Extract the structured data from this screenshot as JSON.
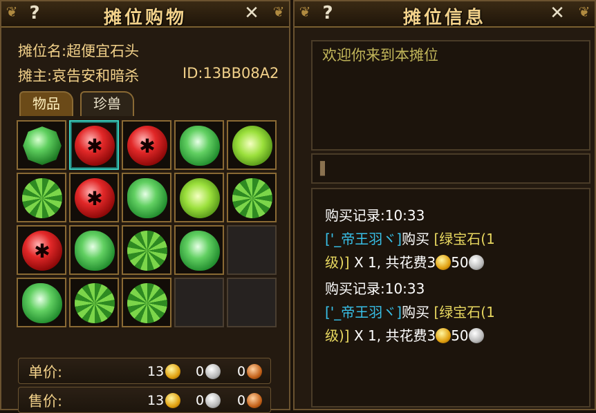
{
  "left": {
    "title": "摊位购物",
    "help": "?",
    "close": "✕",
    "stall_name": "摊位名:超便宜石头",
    "owner_label": "摊主:哀告安和暗杀",
    "owner_id": "ID:13BB08A2",
    "tabs": [
      "物品",
      "珍兽"
    ],
    "items": [
      "emerald",
      "ruby",
      "ruby",
      "jade",
      "peridot",
      "cut",
      "ruby",
      "jade",
      "peridot",
      "cut",
      "ruby",
      "jade",
      "cut",
      "jade",
      "empty",
      "jade",
      "cut",
      "cut",
      "empty",
      "empty"
    ],
    "selected_index": 1,
    "unit_price": {
      "label": "单价:",
      "gold": "13",
      "silver": "0",
      "copper": "0"
    },
    "sell_price": {
      "label": "售价:",
      "gold": "13",
      "silver": "0",
      "copper": "0"
    }
  },
  "right": {
    "title": "摊位信息",
    "help": "?",
    "close": "✕",
    "welcome": "欢迎你来到本摊位",
    "logs": [
      {
        "header": "购买记录:10:33",
        "buyer": "['_帝王羽ヾ]",
        "action": "购买",
        "item": "[绿宝石(1",
        "item2": "级)]",
        "detail": " X 1, 共花费3",
        "silver": "50"
      },
      {
        "header": "购买记录:10:33",
        "buyer": "['_帝王羽ヾ]",
        "action": "购买",
        "item": "[绿宝石(1",
        "item2": "级)]",
        "detail": " X 1, 共花费3",
        "silver": "50"
      }
    ]
  },
  "colors": {
    "gold_text": "#f2d18a",
    "cyan": "#38c0e8",
    "yellow": "#e8d860",
    "border": "#8a6a34"
  }
}
